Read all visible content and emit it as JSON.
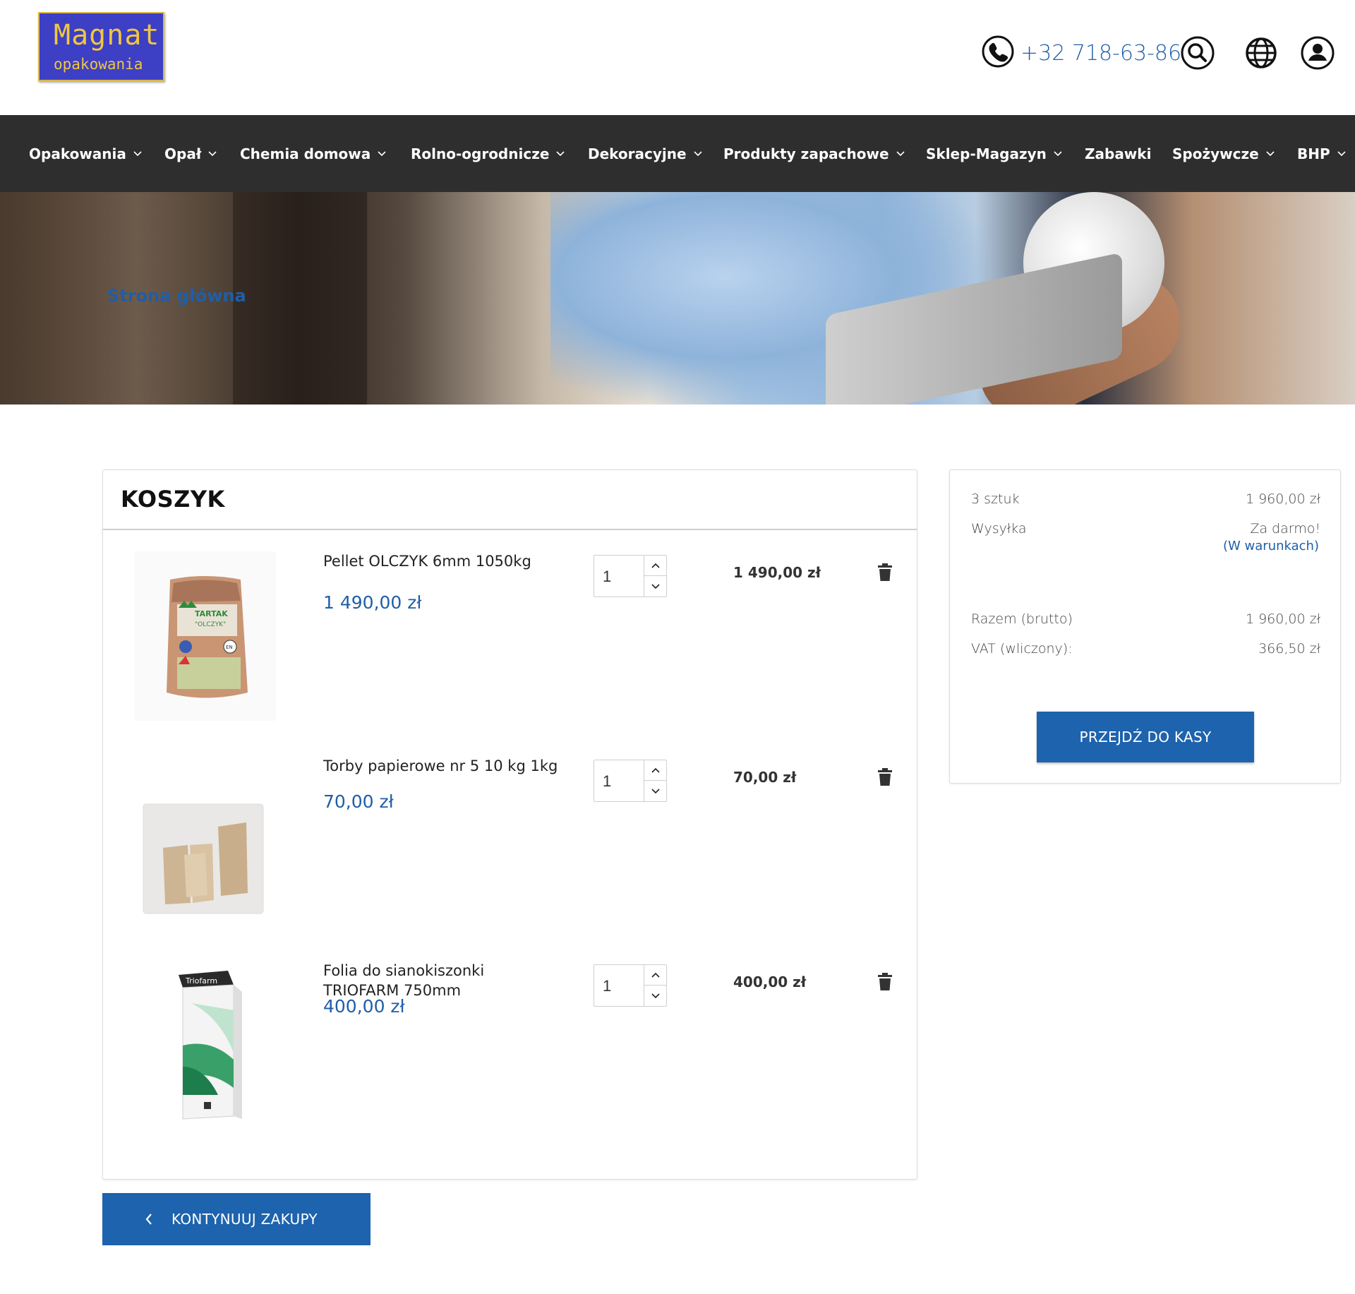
{
  "header": {
    "logo_line1": "Magnat",
    "logo_line2": "opakowania",
    "phone": "+32 718-63-86",
    "icons": [
      "phone-icon",
      "search-icon",
      "globe-icon",
      "user-icon"
    ]
  },
  "nav": {
    "items": [
      {
        "label": "Opakowania",
        "dropdown": true
      },
      {
        "label": "Opał",
        "dropdown": true
      },
      {
        "label": "Chemia domowa",
        "dropdown": true
      },
      {
        "label": "Rolno-ogrodnicze",
        "dropdown": true
      },
      {
        "label": "Dekoracyjne",
        "dropdown": true
      },
      {
        "label": "Produkty zapachowe",
        "dropdown": true
      },
      {
        "label": "Sklep-Magazyn",
        "dropdown": true
      },
      {
        "label": "Zabawki",
        "dropdown": false
      },
      {
        "label": "Spożywcze",
        "dropdown": true
      },
      {
        "label": "BHP",
        "dropdown": true
      }
    ]
  },
  "breadcrumb": "Strona główna",
  "cart": {
    "title": "KOSZYK",
    "items": [
      {
        "name": "Pellet OLCZYK 6mm 1050kg",
        "price": "1 490,00 zł",
        "qty": "1",
        "total": "1 490,00 zł",
        "thumb_text_1": "TARTAK",
        "thumb_text_2": "\"OLCZYK\"",
        "thumb_text_3": "EN"
      },
      {
        "name": "Torby papierowe nr 5 10 kg 1kg",
        "price": "70,00 zł",
        "qty": "1",
        "total": "70,00 zł"
      },
      {
        "name": "Folia do sianokiszonki TRIOFARM 750mm",
        "price": "400,00 zł",
        "qty": "1",
        "total": "400,00 zł",
        "thumb_text_1": "Triofarm"
      }
    ]
  },
  "summary": {
    "count_label": "3 sztuk",
    "count_value": "1 960,00 zł",
    "shipping_label": "Wysyłka",
    "shipping_value": "Za darmo!",
    "conditions_link": "(W warunkach)",
    "total_label": "Razem (brutto)",
    "total_value": "1 960,00 zł",
    "vat_label": "VAT (wliczony):",
    "vat_value": "366,50 zł",
    "checkout_label": "PRZEJDŹ DO KASY"
  },
  "continue_label": "KONTYNUUJ ZAKUPY",
  "colors": {
    "accent": "#1d63ad",
    "link": "#1f5ea8",
    "nav_bg": "#2e2e2e",
    "logo_bg": "#3d3fc4",
    "logo_text": "#f1c640"
  }
}
